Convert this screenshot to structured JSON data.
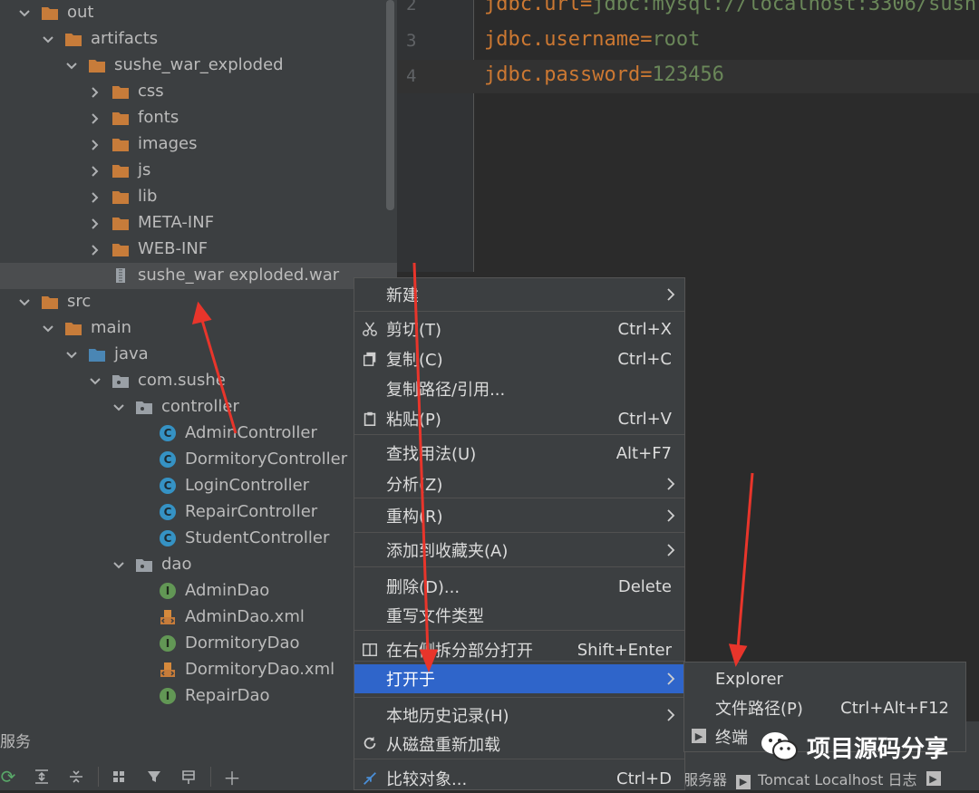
{
  "project_tree": {
    "items": [
      {
        "label": "out",
        "kind": "folder",
        "expanded": true
      },
      {
        "label": "artifacts",
        "kind": "folder",
        "expanded": true
      },
      {
        "label": "sushe_war_exploded",
        "kind": "folder",
        "expanded": true
      },
      {
        "label": "css",
        "kind": "folder",
        "expanded": false
      },
      {
        "label": "fonts",
        "kind": "folder",
        "expanded": false
      },
      {
        "label": "images",
        "kind": "folder",
        "expanded": false
      },
      {
        "label": "js",
        "kind": "folder",
        "expanded": false
      },
      {
        "label": "lib",
        "kind": "folder",
        "expanded": false
      },
      {
        "label": "META-INF",
        "kind": "folder",
        "expanded": false
      },
      {
        "label": "WEB-INF",
        "kind": "folder",
        "expanded": false
      },
      {
        "label": "sushe_war exploded.war",
        "kind": "war-file",
        "selected": true
      },
      {
        "label": "src",
        "kind": "folder",
        "expanded": true
      },
      {
        "label": "main",
        "kind": "folder",
        "expanded": true
      },
      {
        "label": "java",
        "kind": "source-folder",
        "expanded": true
      },
      {
        "label": "com.sushe",
        "kind": "package",
        "expanded": true
      },
      {
        "label": "controller",
        "kind": "package",
        "expanded": true
      },
      {
        "label": "AdminController",
        "kind": "class"
      },
      {
        "label": "DormitoryController",
        "kind": "class"
      },
      {
        "label": "LoginController",
        "kind": "class"
      },
      {
        "label": "RepairController",
        "kind": "class"
      },
      {
        "label": "StudentController",
        "kind": "class"
      },
      {
        "label": "dao",
        "kind": "package",
        "expanded": true
      },
      {
        "label": "AdminDao",
        "kind": "interface"
      },
      {
        "label": "AdminDao.xml",
        "kind": "xml"
      },
      {
        "label": "DormitoryDao",
        "kind": "interface"
      },
      {
        "label": "DormitoryDao.xml",
        "kind": "xml"
      },
      {
        "label": "RepairDao",
        "kind": "interface"
      }
    ]
  },
  "editor": {
    "lines": [
      {
        "num": "2",
        "key": "jdbc.url",
        "eq": "=",
        "value": "jdbc:mysql://localhost:3306/sush"
      },
      {
        "num": "3",
        "key": "jdbc.username",
        "eq": "=",
        "value": "root"
      },
      {
        "num": "4",
        "key": "jdbc.password",
        "eq": "=",
        "value": "123456"
      }
    ]
  },
  "context_menu": {
    "items": [
      {
        "label": "新建",
        "shortcut": "",
        "submenu": true,
        "icon": ""
      },
      {
        "label": "剪切(T)",
        "shortcut": "Ctrl+X",
        "submenu": false,
        "icon": "scissors-icon"
      },
      {
        "label": "复制(C)",
        "shortcut": "Ctrl+C",
        "submenu": false,
        "icon": "copy-icon"
      },
      {
        "label": "复制路径/引用...",
        "shortcut": "",
        "submenu": false,
        "icon": ""
      },
      {
        "label": "粘贴(P)",
        "shortcut": "Ctrl+V",
        "submenu": false,
        "icon": "paste-icon"
      },
      {
        "label": "查找用法(U)",
        "shortcut": "Alt+F7",
        "submenu": false,
        "icon": ""
      },
      {
        "label": "分析(Z)",
        "shortcut": "",
        "submenu": true,
        "icon": ""
      },
      {
        "label": "重构(R)",
        "shortcut": "",
        "submenu": true,
        "icon": ""
      },
      {
        "label": "添加到收藏夹(A)",
        "shortcut": "",
        "submenu": true,
        "icon": ""
      },
      {
        "label": "删除(D)...",
        "shortcut": "Delete",
        "submenu": false,
        "icon": ""
      },
      {
        "label": "重写文件类型",
        "shortcut": "",
        "submenu": false,
        "icon": ""
      },
      {
        "label": "在右侧拆分部分打开",
        "shortcut": "Shift+Enter",
        "submenu": false,
        "icon": "split-icon"
      },
      {
        "label": "打开于",
        "shortcut": "",
        "submenu": true,
        "icon": "",
        "highlighted": true
      },
      {
        "label": "本地历史记录(H)",
        "shortcut": "",
        "submenu": true,
        "icon": ""
      },
      {
        "label": "从磁盘重新加载",
        "shortcut": "",
        "submenu": false,
        "icon": "reload-icon"
      },
      {
        "label": "比较对象...",
        "shortcut": "Ctrl+D",
        "submenu": false,
        "icon": "compare-icon"
      }
    ]
  },
  "submenu": {
    "items": [
      {
        "label": "Explorer",
        "shortcut": "",
        "icon": ""
      },
      {
        "label": "文件路径(P)",
        "shortcut": "Ctrl+Alt+F12",
        "icon": ""
      },
      {
        "label": "终端",
        "shortcut": "",
        "icon": "terminal-icon"
      }
    ]
  },
  "services": {
    "title": "服务",
    "tabs": [
      {
        "label": "服务器"
      },
      {
        "label": "Tomcat Localhost 日志"
      }
    ]
  },
  "watermark": {
    "text": "项目源码分享"
  },
  "colors": {
    "folder": "#c77c3a",
    "source_folder": "#4a86b4",
    "package": "#9aa0a6",
    "class": "#3592c4",
    "interface": "#629755",
    "highlight": "#2f65ca",
    "arrow": "#e8352b"
  }
}
